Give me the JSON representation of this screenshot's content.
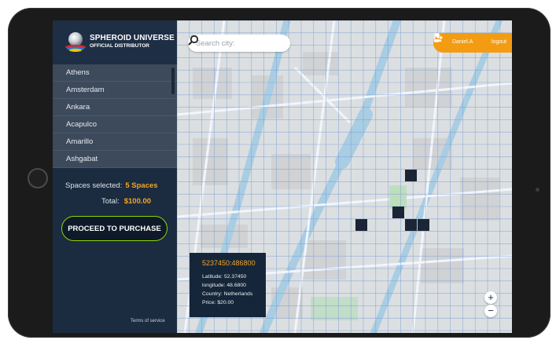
{
  "brand": {
    "title": "SPHEROID UNIVERSE",
    "subtitle": "OFFICIAL DISTRIBUTOR"
  },
  "cities": [
    "Athens",
    "Amsterdam",
    "Ankara",
    "Acapulco",
    "Amarillo",
    "Ashgabat"
  ],
  "summary": {
    "spaces_label": "Spaces selected:",
    "spaces_value": "5 Spaces",
    "total_label": "Total:",
    "total_value": "$100.00"
  },
  "purchase_button": "PROCEED TO PURCHASE",
  "terms": "Terms of service",
  "search": {
    "placeholder": "Search city:"
  },
  "user": {
    "name": "Daniel.A",
    "logout": "logout"
  },
  "info": {
    "id": "5237450:486800",
    "latitude": "Latitude: 52.37450",
    "longitude": "longitude: 48.6800",
    "country": "Country: Netherlands",
    "price": "Price: $20.00"
  },
  "zoom": {
    "in": "+",
    "out": "−"
  },
  "colors": {
    "accent": "#f5a623",
    "badge": "#f39c12",
    "sidebar": "#1b2b40",
    "button_border": "#8fd400",
    "selected_cell": "#1c2535",
    "water": "#a7cde0",
    "grid": "#7a9fd6"
  },
  "icons": {
    "search": "search-icon",
    "user": "user-icon",
    "logout": "logout-icon",
    "logo": "spheroid-logo-icon"
  }
}
